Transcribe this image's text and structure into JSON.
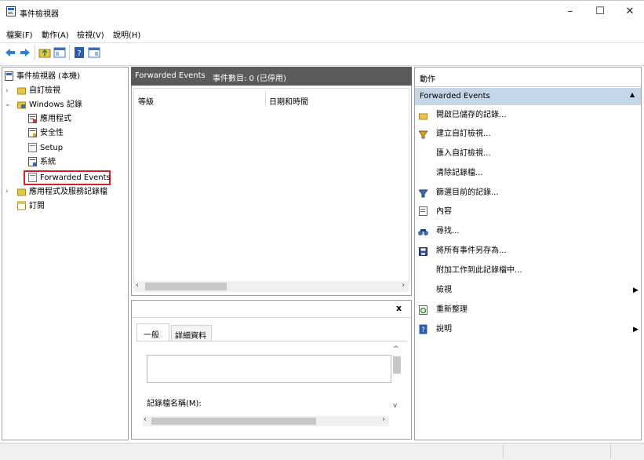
{
  "window": {
    "title": "事件檢視器",
    "controls": {
      "minimize": "–",
      "maximize": "☐",
      "close": "✕"
    }
  },
  "menu": [
    "檔案(F)",
    "動作(A)",
    "檢視(V)",
    "說明(H)"
  ],
  "tree": {
    "items": [
      {
        "label": "事件檢視器 (本機)",
        "icon": "event-viewer-icon"
      },
      {
        "label": "自訂檢視",
        "icon": "folder-icon"
      },
      {
        "label": "Windows 記錄",
        "icon": "folder-icon"
      },
      {
        "label": "應用程式",
        "icon": "log-icon"
      },
      {
        "label": "安全性",
        "icon": "log-icon"
      },
      {
        "label": "Setup",
        "icon": "log-icon"
      },
      {
        "label": "系統",
        "icon": "log-icon"
      },
      {
        "label": "Forwarded Events",
        "icon": "log-icon"
      },
      {
        "label": "應用程式及服務記錄檔",
        "icon": "folder-icon"
      },
      {
        "label": "訂閱",
        "icon": "subscription-icon"
      }
    ]
  },
  "center": {
    "header_title": "Forwarded Events",
    "header_count": "事件數目: 0 (已停用)",
    "columns": [
      "等級",
      "日期和時間"
    ]
  },
  "details": {
    "tabs": [
      "一般",
      "詳細資料"
    ],
    "field_label": "記錄檔名稱(M):",
    "close": "x"
  },
  "actions": {
    "header": "動作",
    "section": "Forwarded Events",
    "items": [
      {
        "label": "開啟已儲存的記錄...",
        "icon": "open-folder-icon"
      },
      {
        "label": "建立自訂檢視...",
        "icon": "filter-icon"
      },
      {
        "label": "匯入自訂檢視...",
        "icon": ""
      },
      {
        "label": "清除記錄檔...",
        "icon": ""
      },
      {
        "label": "篩選目前的記錄...",
        "icon": "filter-icon"
      },
      {
        "label": "內容",
        "icon": "properties-icon"
      },
      {
        "label": "尋找...",
        "icon": "binoculars-icon"
      },
      {
        "label": "將所有事件另存為...",
        "icon": "save-icon"
      },
      {
        "label": "附加工作到此記錄檔中...",
        "icon": ""
      },
      {
        "label": "檢視",
        "icon": ""
      },
      {
        "label": "重新整理",
        "icon": "refresh-icon"
      },
      {
        "label": "說明",
        "icon": "help-icon"
      }
    ]
  },
  "colors": {
    "accent": "#c4d6e8",
    "header_dark": "#5b5b5b",
    "selection_outline": "#d0242c"
  }
}
